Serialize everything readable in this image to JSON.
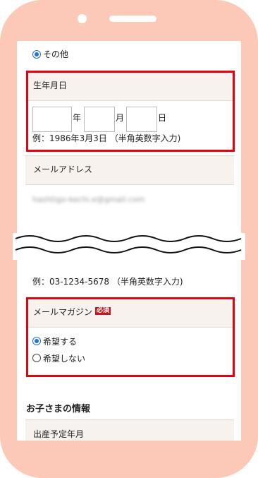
{
  "top_option": {
    "label": "その他"
  },
  "birth": {
    "header": "生年月日",
    "year_unit": "年",
    "month_unit": "月",
    "day_unit": "日",
    "year_value": "",
    "month_value": "",
    "day_value": "",
    "example": "例：1986年3月3日 （半角英数字入力)"
  },
  "email": {
    "header": "メールアドレス",
    "value": "hashtigo-kechi.e@gmail.com"
  },
  "phone": {
    "example": "例：03-1234-5678 （半角英数字入力)"
  },
  "magazine": {
    "header": "メールマガジン",
    "required_badge": "必須",
    "options": [
      {
        "label": "希望する",
        "selected": true
      },
      {
        "label": "希望しない",
        "selected": false
      }
    ]
  },
  "children": {
    "title": "お子さまの情報",
    "due_date_header": "出産予定年月"
  },
  "colors": {
    "phone_frame": "#fcc8b8",
    "highlight": "#e3000f",
    "radio_accent": "#1a73e8",
    "required_badge": "#c8161d"
  }
}
